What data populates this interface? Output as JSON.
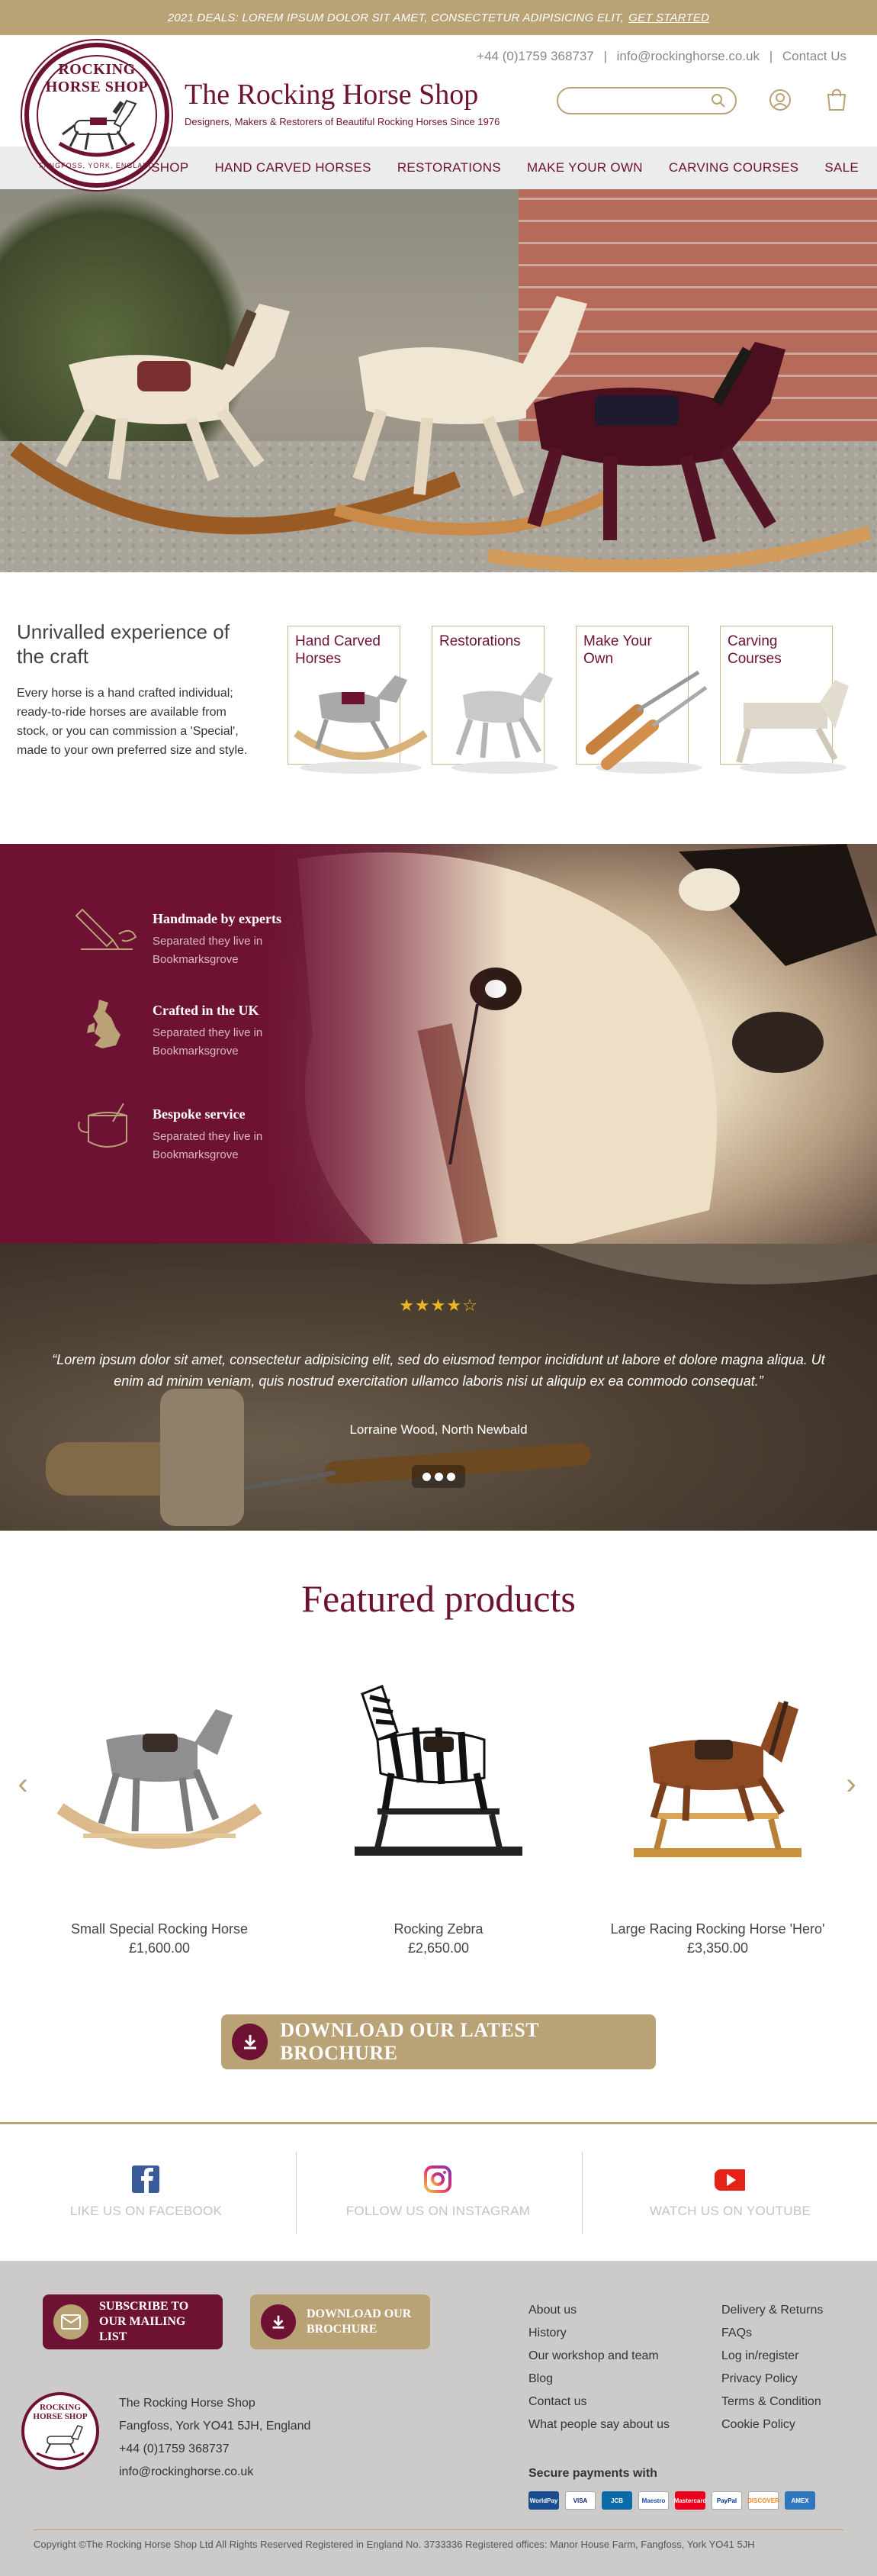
{
  "promo": {
    "text": "2021 DEALS: LOREM IPSUM DOLOR SIT AMET, CONSECTETUR ADIPISICING ELIT,",
    "cta": "GET STARTED"
  },
  "header": {
    "logo_top": "ROCKING HORSE SHOP",
    "logo_bottom": "FANGFOSS, YORK, ENGLAND",
    "title": "The Rocking Horse Shop",
    "tagline": "Designers, Makers & Restorers of Beautiful Rocking Horses Since 1976",
    "phone": "+44 (0)1759 368737",
    "sep": "|",
    "email": "info@rockinghorse.co.uk",
    "contact": "Contact Us",
    "search_placeholder": ""
  },
  "nav": [
    "SHOP",
    "HAND CARVED HORSES",
    "RESTORATIONS",
    "MAKE YOUR OWN",
    "CARVING COURSES",
    "SALE"
  ],
  "intro": {
    "heading": "Unrivalled experience of the craft",
    "body": "Every horse is a hand crafted individual; ready-to-ride horses are available from stock, or you can commission a 'Special', made to your own preferred size and style.",
    "cards": [
      "Hand Carved Horses",
      "Restorations",
      "Make Your Own",
      "Carving Courses"
    ]
  },
  "features": [
    {
      "title": "Handmade by experts",
      "desc": "Separated they live in Bookmarksgrove",
      "icon": "carving-tool-icon"
    },
    {
      "title": "Crafted in the UK",
      "desc": "Separated they live in Bookmarksgrove",
      "icon": "uk-map-icon"
    },
    {
      "title": "Bespoke service",
      "desc": "Separated they live in Bookmarksgrove",
      "icon": "paint-pot-icon"
    }
  ],
  "testimonial": {
    "stars": "★★★★☆",
    "quote": "“Lorem ipsum dolor sit amet, consectetur adipisicing elit, sed do eiusmod tempor incididunt ut labore et dolore magna aliqua. Ut enim ad minim veniam, quis nostrud exercitation ullamco laboris nisi ut aliquip ex ea commodo consequat.”",
    "author": "Lorraine Wood, North Newbald"
  },
  "featured": {
    "heading": "Featured products",
    "products": [
      {
        "name": "Small Special Rocking Horse",
        "price": "£1,600.00"
      },
      {
        "name": "Rocking Zebra",
        "price": "£2,650.00"
      },
      {
        "name": "Large Racing Rocking Horse 'Hero'",
        "price": "£3,350.00"
      }
    ],
    "prev": "‹",
    "next": "›",
    "brochure": "DOWNLOAD OUR LATEST BROCHURE"
  },
  "social": [
    {
      "label": "LIKE US ON FACEBOOK",
      "icon": "facebook-icon"
    },
    {
      "label": "FOLLOW US ON INSTAGRAM",
      "icon": "instagram-icon"
    },
    {
      "label": "WATCH US ON YOUTUBE",
      "icon": "youtube-icon"
    }
  ],
  "footer": {
    "subscribe": "SUBSCRIBE TO OUR MAILING LIST",
    "download": "DOWNLOAD OUR BROCHURE",
    "logo_text": "ROCKING HORSE SHOP",
    "address": [
      "The Rocking Horse Shop",
      "Fangfoss, York YO41 5JH, England",
      "+44 (0)1759 368737",
      "info@rockinghorse.co.uk"
    ],
    "links1": [
      "About us",
      "History",
      "Our workshop and team",
      "Blog",
      "Contact us",
      "What people say about us"
    ],
    "links2": [
      "Delivery & Returns",
      "FAQs",
      "Log in/register",
      "Privacy Policy",
      "Terms & Condition",
      "Cookie Policy"
    ],
    "secure": "Secure payments with",
    "payments": [
      "WorldPay",
      "VISA",
      "JCB",
      "Maestro",
      "Mastercard",
      "PayPal",
      "DISCOVER",
      "AMEX"
    ],
    "copyright": "Copyright ©The Rocking Horse Shop Ltd All Rights Reserved Registered in England No. 3733336 Registered offices: Manor House Farm, Fangfoss, York YO41 5JH"
  },
  "colors": {
    "brand": "#6e1234",
    "gold": "#b9a276",
    "nav_bg": "#ececec",
    "footer_bg": "#cccbca"
  }
}
